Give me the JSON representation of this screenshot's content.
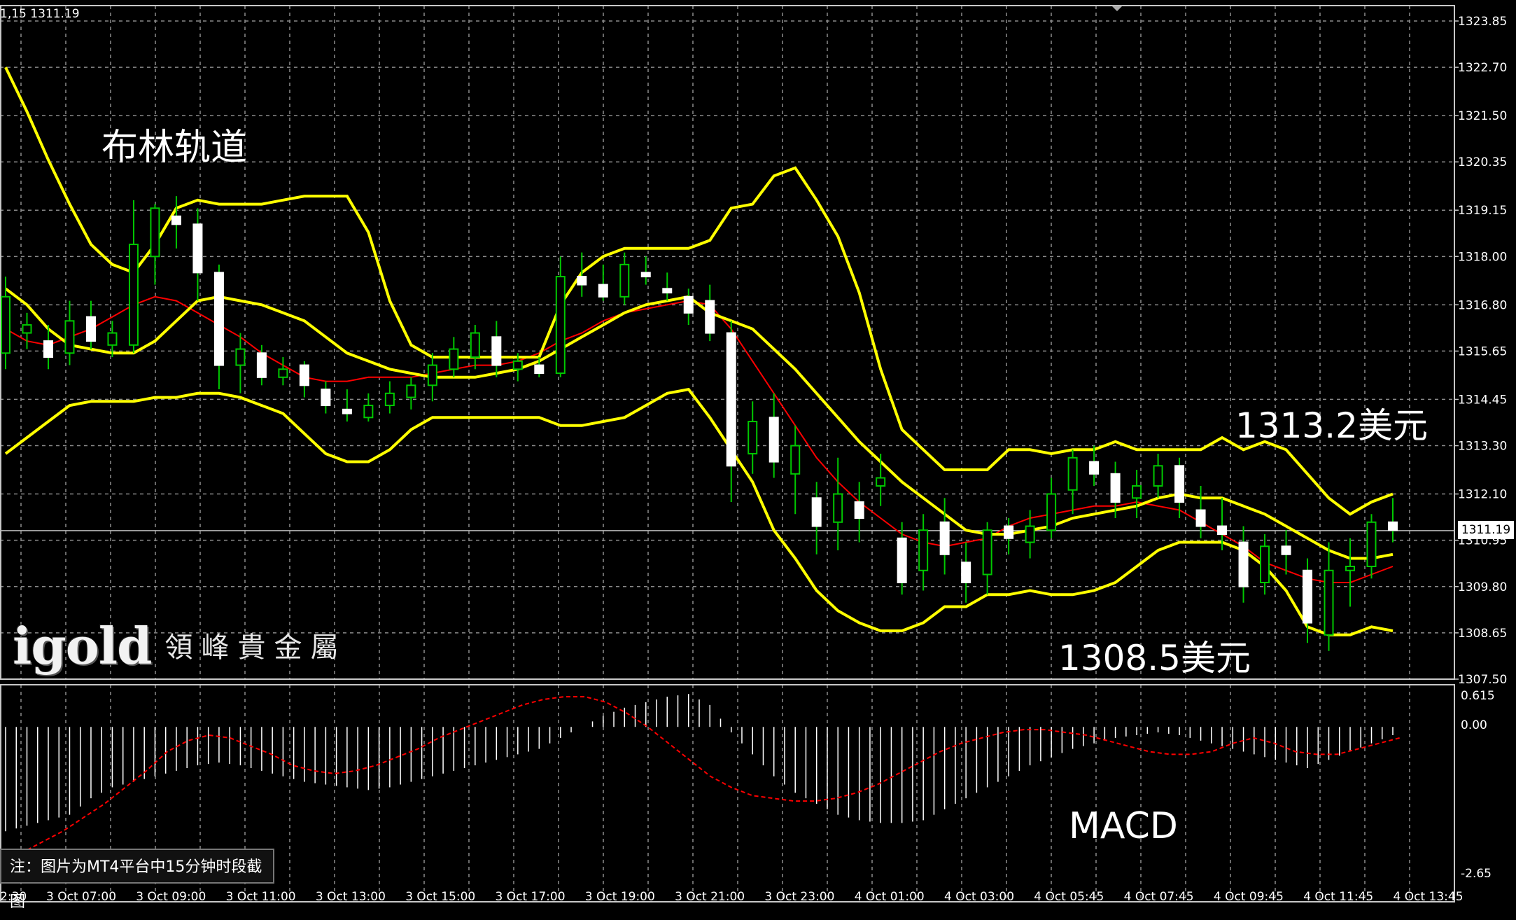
{
  "readout": "1,15 1311.19",
  "annotations": {
    "title": "布林轨道",
    "upper_value": "1313.2美元",
    "lower_value": "1308.5美元",
    "indicator": "MACD"
  },
  "logo": {
    "word": "igold",
    "chinese": "領峰貴金屬"
  },
  "note": "注：图片为MT4平台中15分钟时段截图",
  "current_price": "1311.19",
  "colors": {
    "background": "#000000",
    "grid": "#8a8a8a",
    "band": "#ffff00",
    "ma": "#ff0000",
    "candle_up": "#00c800",
    "candle_down": "#ffffff",
    "macd_hist": "#ffffff",
    "macd_signal": "#ff0000",
    "axis_text": "#ffffff"
  },
  "chart_data": {
    "type": "candlestick",
    "instrument": "XAUUSD",
    "price_axis": {
      "range": [
        1307.5,
        1324.4
      ],
      "ticks": [
        "1323.85",
        "1322.70",
        "1321.50",
        "1320.35",
        "1319.15",
        "1318.00",
        "1316.80",
        "1315.65",
        "1314.45",
        "1313.30",
        "1312.10",
        "1310.95",
        "1309.80",
        "1308.65",
        "1307.50"
      ]
    },
    "time_axis": {
      "labels": [
        "2:30",
        "3 Oct 07:00",
        "3 Oct 09:00",
        "3 Oct 11:00",
        "3 Oct 13:00",
        "3 Oct 15:00",
        "3 Oct 17:00",
        "3 Oct 19:00",
        "3 Oct 21:00",
        "3 Oct 23:00",
        "4 Oct 01:00",
        "4 Oct 03:00",
        "4 Oct 05:45",
        "4 Oct 07:45",
        "4 Oct 09:45",
        "4 Oct 11:45",
        "4 Oct 13:45"
      ]
    },
    "bollinger_upper": [
      1322.7,
      1321.6,
      1320.4,
      1319.3,
      1318.3,
      1317.8,
      1317.6,
      1318.3,
      1319.2,
      1319.4,
      1319.3,
      1319.3,
      1319.3,
      1319.4,
      1319.5,
      1319.5,
      1319.5,
      1318.6,
      1316.9,
      1315.8,
      1315.5,
      1315.5,
      1315.5,
      1315.5,
      1315.5,
      1315.5,
      1316.8,
      1317.6,
      1318.0,
      1318.2,
      1318.2,
      1318.2,
      1318.2,
      1318.4,
      1319.2,
      1319.3,
      1320.0,
      1320.2,
      1319.4,
      1318.5,
      1317.1,
      1315.2,
      1313.7,
      1313.2,
      1312.7,
      1312.7,
      1312.7,
      1313.2,
      1313.2,
      1313.1,
      1313.2,
      1313.2,
      1313.4,
      1313.2,
      1313.2,
      1313.2,
      1313.2,
      1313.5,
      1313.2,
      1313.4,
      1313.2,
      1312.6,
      1312.0,
      1311.6,
      1311.9,
      1312.1
    ],
    "bollinger_middle": [
      1317.2,
      1316.8,
      1316.2,
      1315.8,
      1315.7,
      1315.6,
      1315.6,
      1315.9,
      1316.4,
      1316.9,
      1317.0,
      1316.9,
      1316.8,
      1316.6,
      1316.4,
      1316.0,
      1315.6,
      1315.4,
      1315.2,
      1315.1,
      1315.0,
      1315.0,
      1315.0,
      1315.1,
      1315.2,
      1315.4,
      1315.7,
      1316.0,
      1316.3,
      1316.6,
      1316.8,
      1316.9,
      1317.0,
      1316.6,
      1316.4,
      1316.2,
      1315.7,
      1315.2,
      1314.6,
      1314.0,
      1313.4,
      1312.9,
      1312.4,
      1312.0,
      1311.6,
      1311.2,
      1311.1,
      1311.1,
      1311.2,
      1311.3,
      1311.5,
      1311.6,
      1311.7,
      1311.8,
      1312.0,
      1312.1,
      1312.0,
      1312.0,
      1311.8,
      1311.6,
      1311.3,
      1311.0,
      1310.7,
      1310.5,
      1310.5,
      1310.6
    ],
    "bollinger_lower": [
      1313.1,
      1313.5,
      1313.9,
      1314.3,
      1314.4,
      1314.4,
      1314.4,
      1314.5,
      1314.5,
      1314.6,
      1314.6,
      1314.5,
      1314.3,
      1314.1,
      1313.6,
      1313.1,
      1312.9,
      1312.9,
      1313.2,
      1313.7,
      1314.0,
      1314.0,
      1314.0,
      1314.0,
      1314.0,
      1314.0,
      1313.8,
      1313.8,
      1313.9,
      1314.0,
      1314.3,
      1314.6,
      1314.7,
      1314.0,
      1313.2,
      1312.4,
      1311.2,
      1310.5,
      1309.7,
      1309.2,
      1308.9,
      1308.7,
      1308.7,
      1308.9,
      1309.3,
      1309.3,
      1309.6,
      1309.6,
      1309.7,
      1309.6,
      1309.6,
      1309.7,
      1309.9,
      1310.3,
      1310.7,
      1310.9,
      1310.9,
      1310.9,
      1310.7,
      1310.3,
      1309.7,
      1308.8,
      1308.6,
      1308.6,
      1308.8,
      1308.7
    ],
    "ma": [
      1316.2,
      1315.9,
      1315.8,
      1316.0,
      1316.2,
      1316.5,
      1316.8,
      1317.0,
      1316.9,
      1316.6,
      1316.3,
      1316.0,
      1315.6,
      1315.3,
      1315.0,
      1314.9,
      1314.9,
      1315.0,
      1315.0,
      1315.0,
      1315.1,
      1315.2,
      1315.3,
      1315.3,
      1315.4,
      1315.6,
      1315.9,
      1316.1,
      1316.4,
      1316.6,
      1316.7,
      1316.8,
      1316.9,
      1316.8,
      1316.2,
      1315.4,
      1314.6,
      1313.8,
      1313.0,
      1312.4,
      1311.9,
      1311.5,
      1311.1,
      1310.9,
      1310.8,
      1310.9,
      1311.0,
      1311.3,
      1311.5,
      1311.6,
      1311.7,
      1311.8,
      1311.8,
      1311.9,
      1311.8,
      1311.7,
      1311.4,
      1311.1,
      1310.8,
      1310.4,
      1310.2,
      1310.0,
      1309.9,
      1309.9,
      1310.1,
      1310.3
    ],
    "candles": [
      {
        "o": 1315.6,
        "h": 1317.5,
        "l": 1315.2,
        "c": 1317.0
      },
      {
        "o": 1316.1,
        "h": 1316.6,
        "l": 1315.7,
        "c": 1316.3
      },
      {
        "o": 1315.9,
        "h": 1316.3,
        "l": 1315.2,
        "c": 1315.5
      },
      {
        "o": 1315.6,
        "h": 1316.9,
        "l": 1315.3,
        "c": 1316.4
      },
      {
        "o": 1316.5,
        "h": 1316.9,
        "l": 1315.7,
        "c": 1315.9
      },
      {
        "o": 1315.8,
        "h": 1316.4,
        "l": 1315.5,
        "c": 1316.1
      },
      {
        "o": 1315.8,
        "h": 1319.4,
        "l": 1315.6,
        "c": 1318.3
      },
      {
        "o": 1318.0,
        "h": 1319.3,
        "l": 1317.3,
        "c": 1319.2
      },
      {
        "o": 1319.0,
        "h": 1319.5,
        "l": 1318.2,
        "c": 1318.8
      },
      {
        "o": 1318.8,
        "h": 1319.2,
        "l": 1316.9,
        "c": 1317.6
      },
      {
        "o": 1317.6,
        "h": 1317.8,
        "l": 1314.7,
        "c": 1315.3
      },
      {
        "o": 1315.3,
        "h": 1316.1,
        "l": 1314.6,
        "c": 1315.7
      },
      {
        "o": 1315.6,
        "h": 1315.8,
        "l": 1314.8,
        "c": 1315.0
      },
      {
        "o": 1315.0,
        "h": 1315.5,
        "l": 1314.8,
        "c": 1315.2
      },
      {
        "o": 1315.3,
        "h": 1315.4,
        "l": 1314.5,
        "c": 1314.8
      },
      {
        "o": 1314.7,
        "h": 1314.9,
        "l": 1314.1,
        "c": 1314.3
      },
      {
        "o": 1314.2,
        "h": 1314.7,
        "l": 1313.9,
        "c": 1314.1
      },
      {
        "o": 1314.0,
        "h": 1314.6,
        "l": 1313.9,
        "c": 1314.3
      },
      {
        "o": 1314.3,
        "h": 1314.9,
        "l": 1314.1,
        "c": 1314.6
      },
      {
        "o": 1314.5,
        "h": 1315.0,
        "l": 1314.2,
        "c": 1314.8
      },
      {
        "o": 1314.8,
        "h": 1315.6,
        "l": 1314.4,
        "c": 1315.3
      },
      {
        "o": 1315.2,
        "h": 1316.0,
        "l": 1315.0,
        "c": 1315.7
      },
      {
        "o": 1315.5,
        "h": 1316.3,
        "l": 1315.2,
        "c": 1316.1
      },
      {
        "o": 1316.0,
        "h": 1316.4,
        "l": 1315.0,
        "c": 1315.3
      },
      {
        "o": 1315.2,
        "h": 1315.6,
        "l": 1314.9,
        "c": 1315.4
      },
      {
        "o": 1315.3,
        "h": 1315.5,
        "l": 1315.0,
        "c": 1315.1
      },
      {
        "o": 1315.1,
        "h": 1318.0,
        "l": 1315.0,
        "c": 1317.5
      },
      {
        "o": 1317.5,
        "h": 1318.1,
        "l": 1317.0,
        "c": 1317.3
      },
      {
        "o": 1317.3,
        "h": 1317.8,
        "l": 1316.9,
        "c": 1317.0
      },
      {
        "o": 1317.0,
        "h": 1318.1,
        "l": 1316.8,
        "c": 1317.8
      },
      {
        "o": 1317.6,
        "h": 1318.0,
        "l": 1317.3,
        "c": 1317.5
      },
      {
        "o": 1317.2,
        "h": 1317.6,
        "l": 1316.9,
        "c": 1317.1
      },
      {
        "o": 1317.0,
        "h": 1317.2,
        "l": 1316.3,
        "c": 1316.6
      },
      {
        "o": 1316.9,
        "h": 1317.3,
        "l": 1315.9,
        "c": 1316.1
      },
      {
        "o": 1316.1,
        "h": 1316.4,
        "l": 1311.9,
        "c": 1312.8
      },
      {
        "o": 1313.1,
        "h": 1314.4,
        "l": 1312.6,
        "c": 1313.9
      },
      {
        "o": 1314.0,
        "h": 1314.6,
        "l": 1312.5,
        "c": 1312.9
      },
      {
        "o": 1312.6,
        "h": 1313.8,
        "l": 1311.6,
        "c": 1313.3
      },
      {
        "o": 1312.0,
        "h": 1312.4,
        "l": 1310.6,
        "c": 1311.3
      },
      {
        "o": 1311.4,
        "h": 1313.0,
        "l": 1310.7,
        "c": 1312.1
      },
      {
        "o": 1311.9,
        "h": 1312.4,
        "l": 1310.9,
        "c": 1311.5
      },
      {
        "o": 1312.3,
        "h": 1313.1,
        "l": 1311.8,
        "c": 1312.5
      },
      {
        "o": 1311.0,
        "h": 1311.4,
        "l": 1309.6,
        "c": 1309.9
      },
      {
        "o": 1310.2,
        "h": 1311.6,
        "l": 1309.7,
        "c": 1311.2
      },
      {
        "o": 1311.4,
        "h": 1312.0,
        "l": 1310.1,
        "c": 1310.6
      },
      {
        "o": 1310.4,
        "h": 1310.9,
        "l": 1309.4,
        "c": 1309.9
      },
      {
        "o": 1310.1,
        "h": 1311.4,
        "l": 1309.6,
        "c": 1311.2
      },
      {
        "o": 1311.3,
        "h": 1311.5,
        "l": 1310.6,
        "c": 1311.0
      },
      {
        "o": 1310.9,
        "h": 1311.7,
        "l": 1310.5,
        "c": 1311.3
      },
      {
        "o": 1311.2,
        "h": 1312.5,
        "l": 1311.0,
        "c": 1312.1
      },
      {
        "o": 1312.2,
        "h": 1313.2,
        "l": 1311.6,
        "c": 1313.0
      },
      {
        "o": 1312.9,
        "h": 1313.3,
        "l": 1312.3,
        "c": 1312.6
      },
      {
        "o": 1312.6,
        "h": 1312.9,
        "l": 1311.5,
        "c": 1311.9
      },
      {
        "o": 1312.0,
        "h": 1312.7,
        "l": 1311.5,
        "c": 1312.3
      },
      {
        "o": 1312.3,
        "h": 1313.1,
        "l": 1312.0,
        "c": 1312.8
      },
      {
        "o": 1312.8,
        "h": 1313.0,
        "l": 1311.5,
        "c": 1311.9
      },
      {
        "o": 1311.7,
        "h": 1312.3,
        "l": 1311.0,
        "c": 1311.3
      },
      {
        "o": 1311.3,
        "h": 1312.0,
        "l": 1310.7,
        "c": 1311.1
      },
      {
        "o": 1310.9,
        "h": 1311.3,
        "l": 1309.4,
        "c": 1309.8
      },
      {
        "o": 1309.9,
        "h": 1311.1,
        "l": 1309.6,
        "c": 1310.8
      },
      {
        "o": 1310.8,
        "h": 1311.2,
        "l": 1310.1,
        "c": 1310.6
      },
      {
        "o": 1310.2,
        "h": 1310.5,
        "l": 1308.4,
        "c": 1308.9
      },
      {
        "o": 1308.6,
        "h": 1310.9,
        "l": 1308.2,
        "c": 1310.2
      },
      {
        "o": 1310.2,
        "h": 1311.0,
        "l": 1309.3,
        "c": 1310.3
      },
      {
        "o": 1310.3,
        "h": 1311.6,
        "l": 1310.0,
        "c": 1311.4
      },
      {
        "o": 1311.4,
        "h": 1312.0,
        "l": 1310.9,
        "c": 1311.2
      }
    ],
    "macd_axis": {
      "ticks": [
        "0.615",
        "0.00",
        "-2.65"
      ],
      "range": [
        -2.65,
        0.615
      ]
    },
    "macd_histogram": [
      -1.9,
      -1.8,
      -1.7,
      -1.6,
      -1.3,
      -1.1,
      -1.0,
      -0.9,
      -0.8,
      -0.7,
      -0.65,
      -0.7,
      -0.8,
      -0.9,
      -1.0,
      -1.05,
      -1.1,
      -1.15,
      -1.1,
      -1.0,
      -0.9,
      -0.8,
      -0.7,
      -0.6,
      -0.5,
      -0.4,
      -0.2,
      0.0,
      0.2,
      0.35,
      0.45,
      0.55,
      0.6,
      0.4,
      -0.1,
      -0.5,
      -0.9,
      -1.2,
      -1.4,
      -1.6,
      -1.7,
      -1.75,
      -1.75,
      -1.7,
      -1.5,
      -1.3,
      -1.1,
      -0.9,
      -0.7,
      -0.55,
      -0.4,
      -0.3,
      -0.2,
      -0.15,
      -0.1,
      -0.15,
      -0.25,
      -0.35,
      -0.45,
      -0.55,
      -0.65,
      -0.75,
      -0.6,
      -0.45,
      -0.3,
      -0.15
    ],
    "macd_signal": [
      -2.3,
      -2.1,
      -1.9,
      -1.65,
      -1.4,
      -1.1,
      -0.8,
      -0.45,
      -0.25,
      -0.15,
      -0.2,
      -0.35,
      -0.5,
      -0.7,
      -0.8,
      -0.85,
      -0.8,
      -0.7,
      -0.55,
      -0.4,
      -0.2,
      -0.05,
      0.1,
      0.25,
      0.4,
      0.5,
      0.55,
      0.55,
      0.45,
      0.25,
      0.0,
      -0.3,
      -0.6,
      -0.9,
      -1.1,
      -1.25,
      -1.3,
      -1.35,
      -1.35,
      -1.3,
      -1.2,
      -1.05,
      -0.85,
      -0.65,
      -0.45,
      -0.3,
      -0.2,
      -0.1,
      -0.05,
      -0.05,
      -0.1,
      -0.15,
      -0.25,
      -0.35,
      -0.45,
      -0.5,
      -0.5,
      -0.45,
      -0.3,
      -0.2,
      -0.3,
      -0.45,
      -0.5,
      -0.5,
      -0.4,
      -0.3,
      -0.2
    ]
  }
}
